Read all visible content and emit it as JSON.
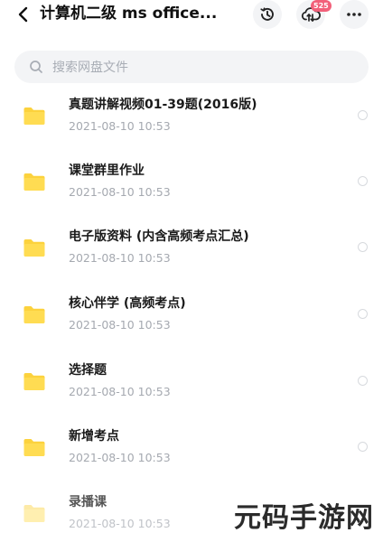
{
  "header": {
    "title": "计算机二级 ms office...",
    "transfer_badge": "525"
  },
  "search": {
    "placeholder": "搜索网盘文件"
  },
  "files": [
    {
      "name": "真题讲解视频01-39题(2016版)",
      "date": "2021-08-10  10:53"
    },
    {
      "name": "课堂群里作业",
      "date": "2021-08-10  10:53"
    },
    {
      "name": "电子版资料 (内含高频考点汇总)",
      "date": "2021-08-10  10:53"
    },
    {
      "name": "核心伴学 (高频考点)",
      "date": "2021-08-10  10:53"
    },
    {
      "name": "选择题",
      "date": "2021-08-10  10:53"
    },
    {
      "name": "新增考点",
      "date": "2021-08-10  10:53"
    },
    {
      "name": "录播课",
      "date": "2021-08-10  10:53"
    }
  ],
  "watermark": "元码手游网",
  "colors": {
    "folder": "#fcd23d",
    "badge": "#f2607a",
    "meta_text": "#a5a9b0",
    "search_bg": "#f3f4f6"
  },
  "icons": {
    "back": "chevron-left-icon",
    "history": "clock-history-icon",
    "transfer": "cloud-transfer-icon",
    "more": "more-dots-icon",
    "search": "search-icon",
    "folder": "folder-icon"
  }
}
